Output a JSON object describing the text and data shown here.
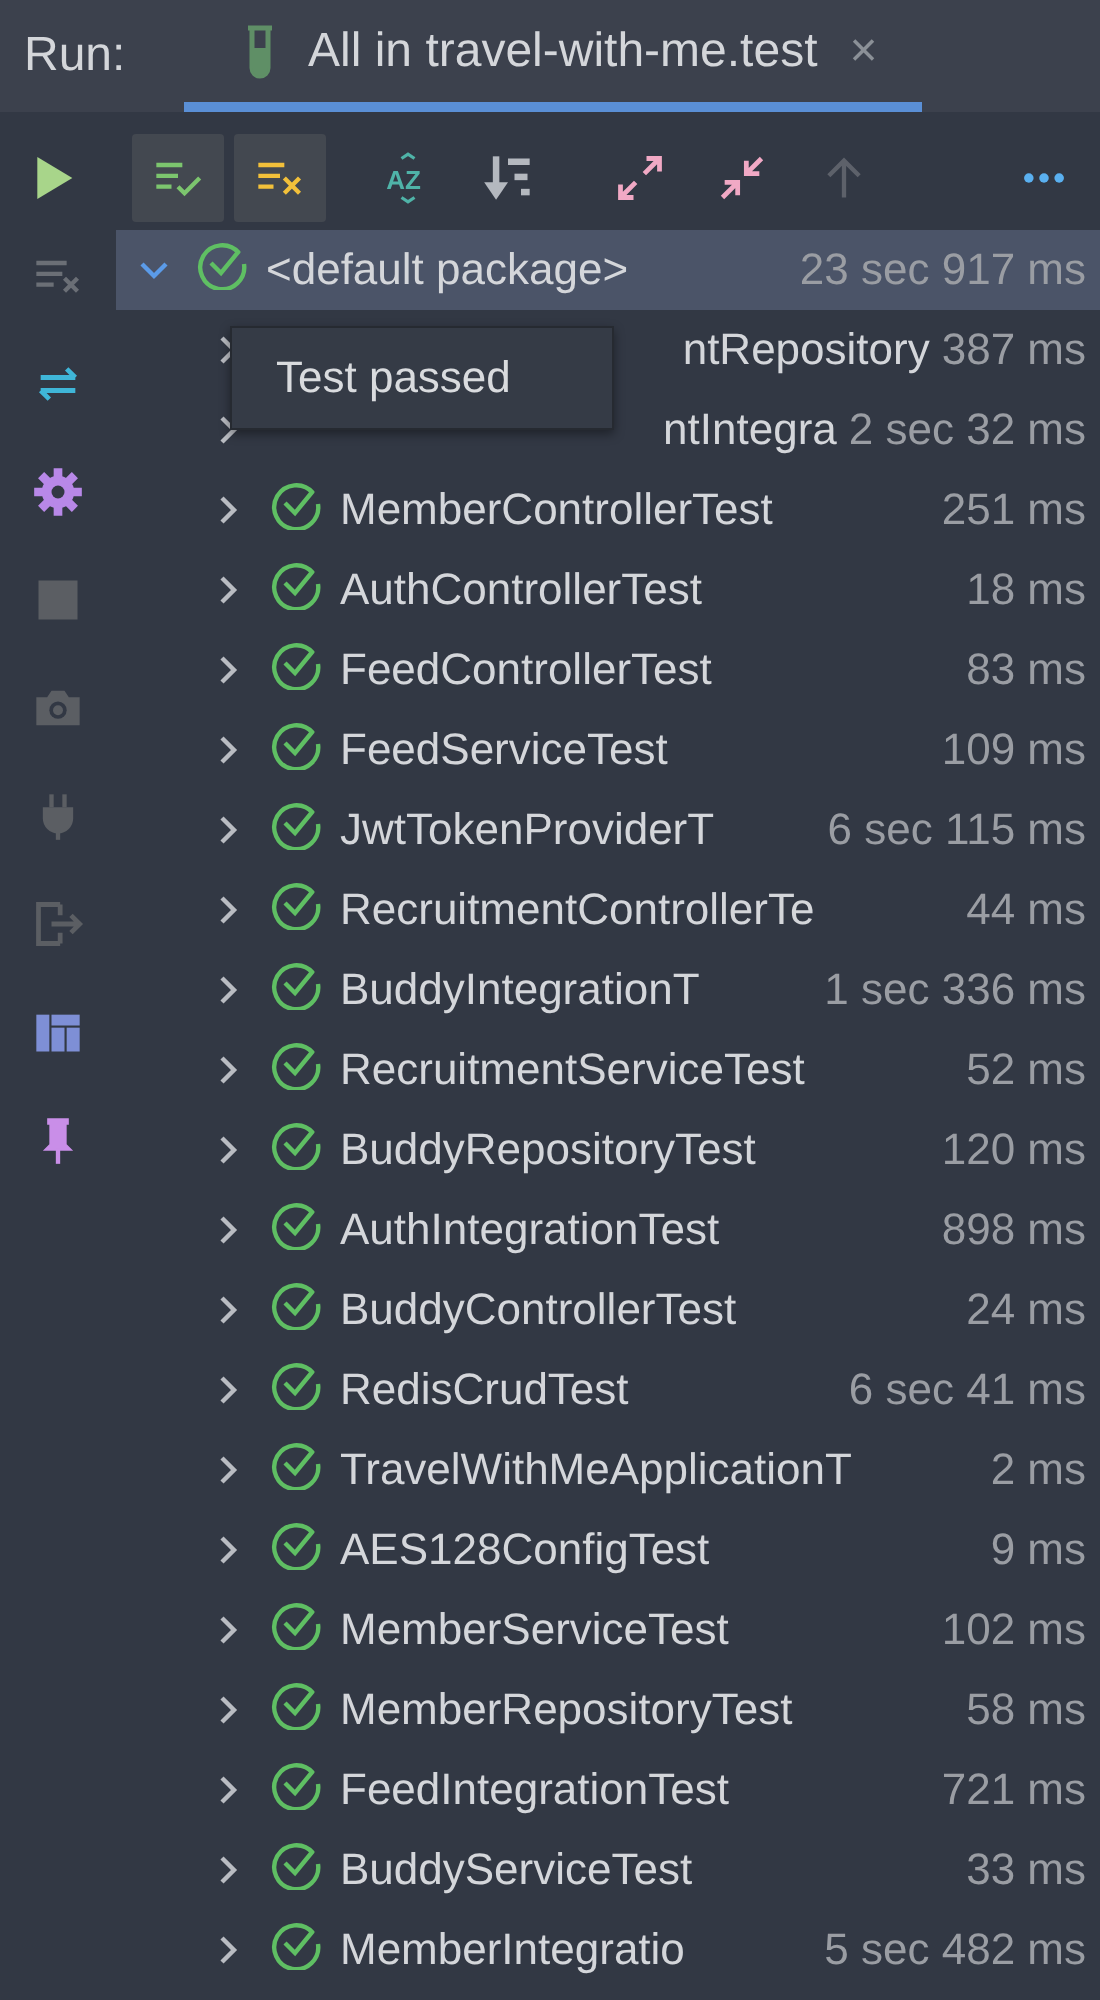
{
  "run_label": "Run:",
  "tab": {
    "title": "All in travel-with-me.test",
    "close": "×",
    "selected": true
  },
  "toolbar": [
    {
      "kind": "run",
      "on": false
    },
    {
      "kind": "show-passed",
      "on": true
    },
    {
      "kind": "show-failed",
      "on": true
    },
    {
      "kind": "sort-alpha",
      "on": false,
      "label": "AZ"
    },
    {
      "kind": "sort-duration",
      "on": false
    },
    {
      "kind": "expand-all",
      "on": false
    },
    {
      "kind": "collapse-all",
      "on": false
    },
    {
      "kind": "previous",
      "on": false
    },
    {
      "kind": "more",
      "on": false
    }
  ],
  "sidebar": [
    {
      "kind": "rerun-failed"
    },
    {
      "kind": "toggle-auto"
    },
    {
      "kind": "settings"
    },
    {
      "kind": "stop"
    },
    {
      "kind": "camera"
    },
    {
      "kind": "plug"
    },
    {
      "kind": "exit"
    },
    {
      "kind": "layout"
    },
    {
      "kind": "pin"
    }
  ],
  "tree": {
    "label": "<default package>",
    "time": "23 sec 917 ms",
    "expanded": true,
    "selected": true,
    "children": [
      {
        "name": "ntRepository",
        "time": "387 ms",
        "expanded": false,
        "kind": "partly-covered"
      },
      {
        "name": "ntIntegra",
        "time": "2 sec 32 ms",
        "expanded": false,
        "kind": "partly-covered"
      },
      {
        "name": "MemberControllerTest",
        "time": "251 ms",
        "expanded": false,
        "kind": "plain"
      },
      {
        "name": "AuthControllerTest",
        "time": "18 ms",
        "expanded": false,
        "kind": "plain"
      },
      {
        "name": "FeedControllerTest",
        "time": "83 ms",
        "expanded": false,
        "kind": "plain"
      },
      {
        "name": "FeedServiceTest",
        "time": "109 ms",
        "expanded": false,
        "kind": "plain"
      },
      {
        "name": "JwtTokenProviderT",
        "time": "6 sec 115 ms",
        "expanded": false,
        "kind": "plain"
      },
      {
        "name": "RecruitmentControllerTe",
        "time": "44 ms",
        "expanded": false,
        "kind": "plain"
      },
      {
        "name": "BuddyIntegrationT",
        "time": "1 sec 336 ms",
        "expanded": false,
        "kind": "plain"
      },
      {
        "name": "RecruitmentServiceTest",
        "time": "52 ms",
        "expanded": false,
        "kind": "plain"
      },
      {
        "name": "BuddyRepositoryTest",
        "time": "120 ms",
        "expanded": false,
        "kind": "plain"
      },
      {
        "name": "AuthIntegrationTest",
        "time": "898 ms",
        "expanded": false,
        "kind": "plain"
      },
      {
        "name": "BuddyControllerTest",
        "time": "24 ms",
        "expanded": false,
        "kind": "plain"
      },
      {
        "name": "RedisCrudTest",
        "time": "6 sec 41 ms",
        "expanded": false,
        "kind": "plain"
      },
      {
        "name": "TravelWithMeApplicationT",
        "time": "2 ms",
        "expanded": false,
        "kind": "plain"
      },
      {
        "name": "AES128ConfigTest",
        "time": "9 ms",
        "expanded": false,
        "kind": "plain"
      },
      {
        "name": "MemberServiceTest",
        "time": "102 ms",
        "expanded": false,
        "kind": "plain"
      },
      {
        "name": "MemberRepositoryTest",
        "time": "58 ms",
        "expanded": false,
        "kind": "plain"
      },
      {
        "name": "FeedIntegrationTest",
        "time": "721 ms",
        "expanded": false,
        "kind": "plain"
      },
      {
        "name": "BuddyServiceTest",
        "time": "33 ms",
        "expanded": false,
        "kind": "plain"
      },
      {
        "name": "MemberIntegratio",
        "time": "5 sec 482 ms",
        "expanded": false,
        "kind": "plain"
      }
    ]
  },
  "tooltip": "Test passed"
}
